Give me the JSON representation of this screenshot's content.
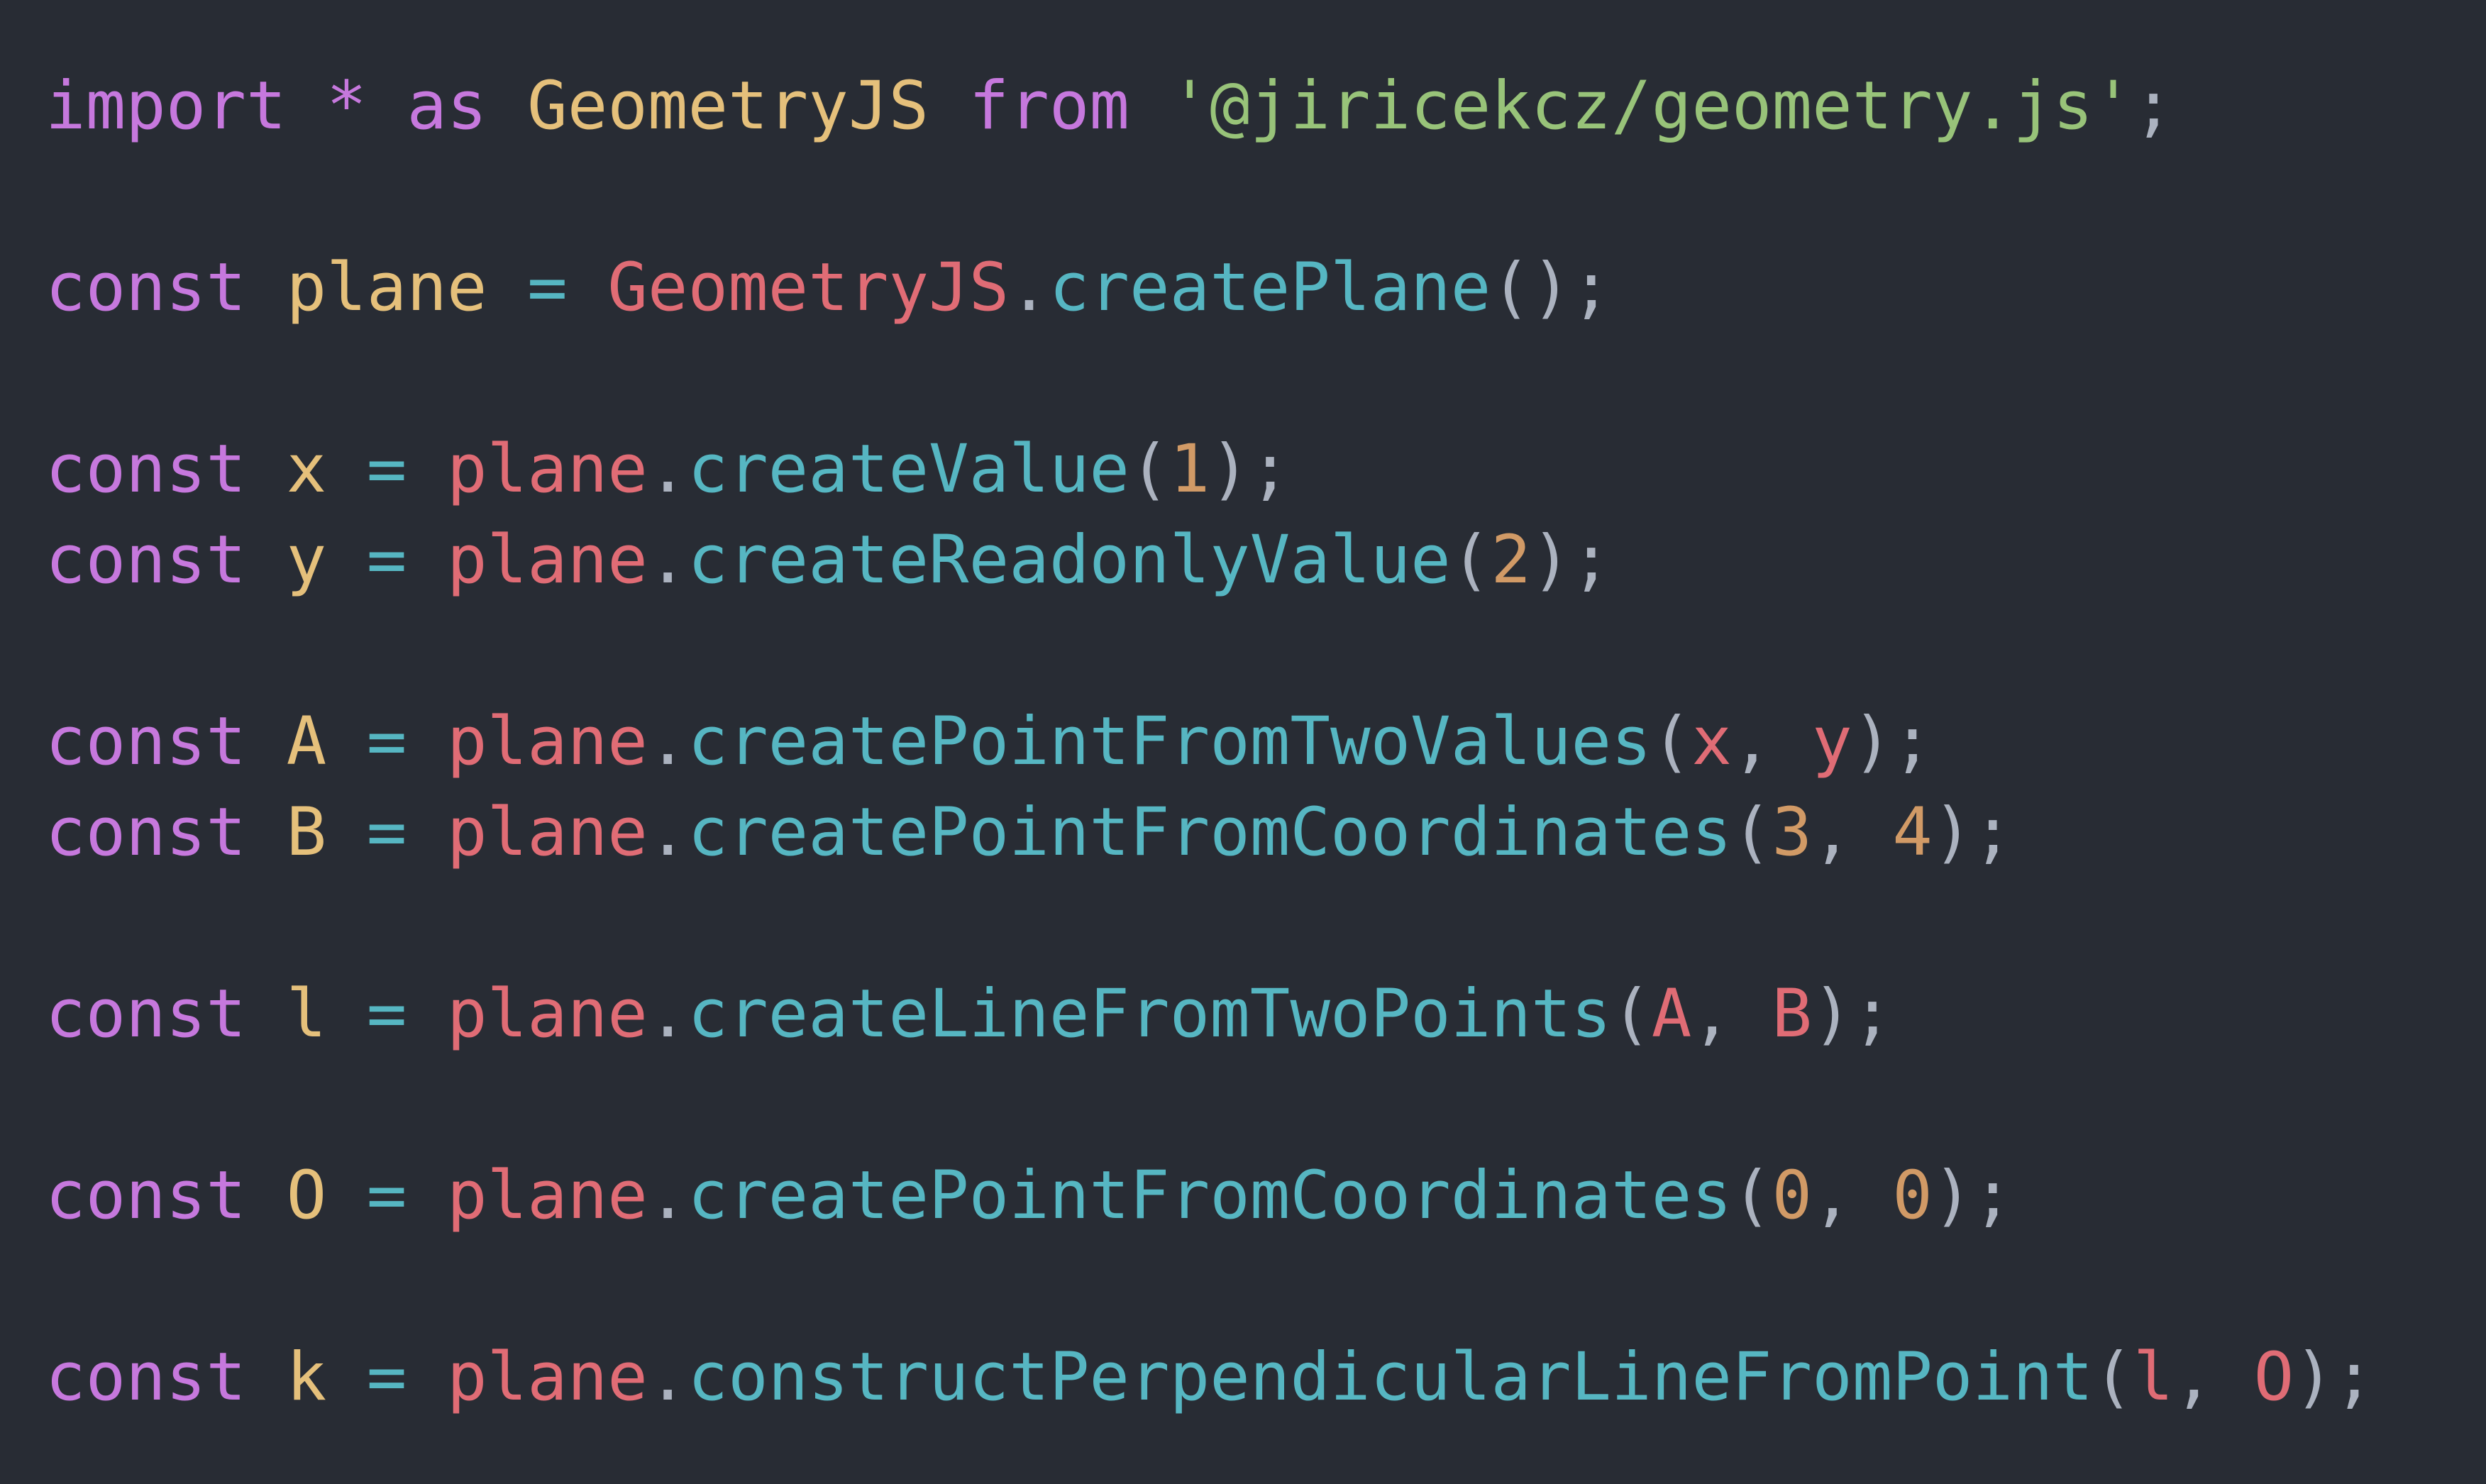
{
  "lines": [
    {
      "tokens": [
        {
          "t": "import",
          "c": "kw"
        },
        {
          "t": " ",
          "c": "punc"
        },
        {
          "t": "*",
          "c": "kw"
        },
        {
          "t": " ",
          "c": "punc"
        },
        {
          "t": "as",
          "c": "kw"
        },
        {
          "t": " ",
          "c": "punc"
        },
        {
          "t": "GeometryJS",
          "c": "cls"
        },
        {
          "t": " ",
          "c": "punc"
        },
        {
          "t": "from",
          "c": "kw"
        },
        {
          "t": " ",
          "c": "punc"
        },
        {
          "t": "'@jiricekcz/geometry.js'",
          "c": "str"
        },
        {
          "t": ";",
          "c": "punc"
        }
      ]
    },
    {
      "tokens": []
    },
    {
      "tokens": [
        {
          "t": "const",
          "c": "kw"
        },
        {
          "t": " ",
          "c": "punc"
        },
        {
          "t": "plane",
          "c": "var"
        },
        {
          "t": " ",
          "c": "punc"
        },
        {
          "t": "=",
          "c": "op"
        },
        {
          "t": " ",
          "c": "punc"
        },
        {
          "t": "GeometryJS",
          "c": "obj"
        },
        {
          "t": ".",
          "c": "punc"
        },
        {
          "t": "createPlane",
          "c": "fn"
        },
        {
          "t": "();",
          "c": "punc"
        }
      ]
    },
    {
      "tokens": []
    },
    {
      "tokens": [
        {
          "t": "const",
          "c": "kw"
        },
        {
          "t": " ",
          "c": "punc"
        },
        {
          "t": "x",
          "c": "var"
        },
        {
          "t": " ",
          "c": "punc"
        },
        {
          "t": "=",
          "c": "op"
        },
        {
          "t": " ",
          "c": "punc"
        },
        {
          "t": "plane",
          "c": "obj"
        },
        {
          "t": ".",
          "c": "punc"
        },
        {
          "t": "createValue",
          "c": "fn"
        },
        {
          "t": "(",
          "c": "punc"
        },
        {
          "t": "1",
          "c": "num"
        },
        {
          "t": ");",
          "c": "punc"
        }
      ]
    },
    {
      "tokens": [
        {
          "t": "const",
          "c": "kw"
        },
        {
          "t": " ",
          "c": "punc"
        },
        {
          "t": "y",
          "c": "var"
        },
        {
          "t": " ",
          "c": "punc"
        },
        {
          "t": "=",
          "c": "op"
        },
        {
          "t": " ",
          "c": "punc"
        },
        {
          "t": "plane",
          "c": "obj"
        },
        {
          "t": ".",
          "c": "punc"
        },
        {
          "t": "createReadonlyValue",
          "c": "fn"
        },
        {
          "t": "(",
          "c": "punc"
        },
        {
          "t": "2",
          "c": "num"
        },
        {
          "t": ");",
          "c": "punc"
        }
      ]
    },
    {
      "tokens": []
    },
    {
      "tokens": [
        {
          "t": "const",
          "c": "kw"
        },
        {
          "t": " ",
          "c": "punc"
        },
        {
          "t": "A",
          "c": "var"
        },
        {
          "t": " ",
          "c": "punc"
        },
        {
          "t": "=",
          "c": "op"
        },
        {
          "t": " ",
          "c": "punc"
        },
        {
          "t": "plane",
          "c": "obj"
        },
        {
          "t": ".",
          "c": "punc"
        },
        {
          "t": "createPointFromTwoValues",
          "c": "fn"
        },
        {
          "t": "(",
          "c": "punc"
        },
        {
          "t": "x",
          "c": "arg"
        },
        {
          "t": ", ",
          "c": "punc"
        },
        {
          "t": "y",
          "c": "arg"
        },
        {
          "t": ");",
          "c": "punc"
        }
      ]
    },
    {
      "tokens": [
        {
          "t": "const",
          "c": "kw"
        },
        {
          "t": " ",
          "c": "punc"
        },
        {
          "t": "B",
          "c": "var"
        },
        {
          "t": " ",
          "c": "punc"
        },
        {
          "t": "=",
          "c": "op"
        },
        {
          "t": " ",
          "c": "punc"
        },
        {
          "t": "plane",
          "c": "obj"
        },
        {
          "t": ".",
          "c": "punc"
        },
        {
          "t": "createPointFromCoordinates",
          "c": "fn"
        },
        {
          "t": "(",
          "c": "punc"
        },
        {
          "t": "3",
          "c": "num"
        },
        {
          "t": ", ",
          "c": "punc"
        },
        {
          "t": "4",
          "c": "num"
        },
        {
          "t": ");",
          "c": "punc"
        }
      ]
    },
    {
      "tokens": []
    },
    {
      "tokens": [
        {
          "t": "const",
          "c": "kw"
        },
        {
          "t": " ",
          "c": "punc"
        },
        {
          "t": "l",
          "c": "var"
        },
        {
          "t": " ",
          "c": "punc"
        },
        {
          "t": "=",
          "c": "op"
        },
        {
          "t": " ",
          "c": "punc"
        },
        {
          "t": "plane",
          "c": "obj"
        },
        {
          "t": ".",
          "c": "punc"
        },
        {
          "t": "createLineFromTwoPoints",
          "c": "fn"
        },
        {
          "t": "(",
          "c": "punc"
        },
        {
          "t": "A",
          "c": "arg"
        },
        {
          "t": ", ",
          "c": "punc"
        },
        {
          "t": "B",
          "c": "arg"
        },
        {
          "t": ");",
          "c": "punc"
        }
      ]
    },
    {
      "tokens": []
    },
    {
      "tokens": [
        {
          "t": "const",
          "c": "kw"
        },
        {
          "t": " ",
          "c": "punc"
        },
        {
          "t": "O",
          "c": "var"
        },
        {
          "t": " ",
          "c": "punc"
        },
        {
          "t": "=",
          "c": "op"
        },
        {
          "t": " ",
          "c": "punc"
        },
        {
          "t": "plane",
          "c": "obj"
        },
        {
          "t": ".",
          "c": "punc"
        },
        {
          "t": "createPointFromCoordinates",
          "c": "fn"
        },
        {
          "t": "(",
          "c": "punc"
        },
        {
          "t": "0",
          "c": "num"
        },
        {
          "t": ", ",
          "c": "punc"
        },
        {
          "t": "0",
          "c": "num"
        },
        {
          "t": ");",
          "c": "punc"
        }
      ]
    },
    {
      "tokens": []
    },
    {
      "tokens": [
        {
          "t": "const",
          "c": "kw"
        },
        {
          "t": " ",
          "c": "punc"
        },
        {
          "t": "k",
          "c": "var"
        },
        {
          "t": " ",
          "c": "punc"
        },
        {
          "t": "=",
          "c": "op"
        },
        {
          "t": " ",
          "c": "punc"
        },
        {
          "t": "plane",
          "c": "obj"
        },
        {
          "t": ".",
          "c": "punc"
        },
        {
          "t": "constructPerpendicularLineFromPoint",
          "c": "fn"
        },
        {
          "t": "(",
          "c": "punc"
        },
        {
          "t": "l",
          "c": "arg"
        },
        {
          "t": ", ",
          "c": "punc"
        },
        {
          "t": "O",
          "c": "arg"
        },
        {
          "t": ");",
          "c": "punc"
        }
      ]
    }
  ],
  "colors": {
    "background": "#282c34",
    "keyword": "#c678dd",
    "variable": "#e5c07b",
    "object": "#e06c75",
    "function": "#56b6c2",
    "number": "#d19a66",
    "string": "#98c379",
    "punctuation": "#abb2bf"
  }
}
